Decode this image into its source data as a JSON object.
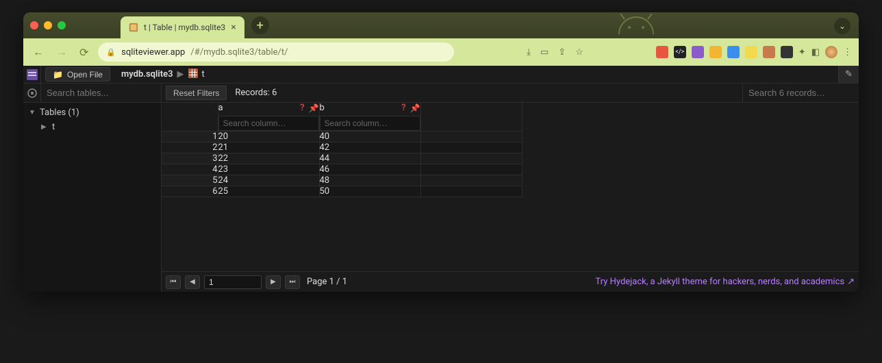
{
  "browser": {
    "tab_title": "t | Table | mydb.sqlite3",
    "url_host": "sqliteviewer.app",
    "url_path": "/#/mydb.sqlite3/table/t/"
  },
  "toolbar": {
    "open_file_label": "Open File",
    "breadcrumb_db": "mydb.sqlite3",
    "breadcrumb_table": "t"
  },
  "subbar": {
    "search_tables_placeholder": "Search tables...",
    "reset_filters_label": "Reset Filters",
    "records_label": "Records: 6",
    "search_records_placeholder": "Search 6 records…"
  },
  "sidebar": {
    "header": "Tables (1)",
    "items": [
      {
        "label": "t"
      }
    ]
  },
  "columns": [
    {
      "name": "a",
      "search_placeholder": "Search column…"
    },
    {
      "name": "b",
      "search_placeholder": "Search column…"
    }
  ],
  "rows": [
    {
      "n": "1",
      "a": "20",
      "b": "40"
    },
    {
      "n": "2",
      "a": "21",
      "b": "42"
    },
    {
      "n": "3",
      "a": "22",
      "b": "44"
    },
    {
      "n": "4",
      "a": "23",
      "b": "46"
    },
    {
      "n": "5",
      "a": "24",
      "b": "48"
    },
    {
      "n": "6",
      "a": "25",
      "b": "50"
    }
  ],
  "footer": {
    "page_input": "1",
    "page_text": "Page 1 / 1",
    "promo": "Try Hydejack, a Jekyll theme for hackers, nerds, and academics"
  }
}
